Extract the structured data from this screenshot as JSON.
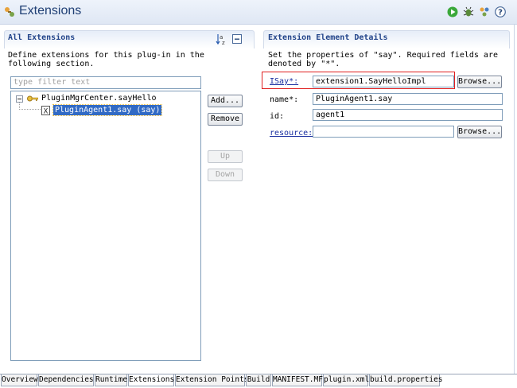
{
  "header": {
    "title": "Extensions"
  },
  "left": {
    "section_title": "All Extensions",
    "description": "Define extensions for this plug-in in the following section.",
    "filter_placeholder": "type filter text",
    "tree": {
      "root_label": "PluginMgrCenter.sayHello",
      "child_label": "PluginAgent1.say (say)"
    },
    "buttons": {
      "add": "Add...",
      "remove": "Remove",
      "up": "Up",
      "down": "Down"
    }
  },
  "right": {
    "section_title": "Extension Element Details",
    "description": "Set the properties of \"say\". Required fields are denoted by \"*\".",
    "fields": {
      "isay": {
        "label": "ISay*:",
        "value": "extension1.SayHelloImpl",
        "browse": "Browse..."
      },
      "name": {
        "label": "name*:",
        "value": "PluginAgent1.say"
      },
      "id": {
        "label": "id:",
        "value": "agent1"
      },
      "resource": {
        "label": "resource:",
        "value": "",
        "browse": "Browse..."
      }
    }
  },
  "tabs": [
    "Overview",
    "Dependencies",
    "Runtime",
    "Extensions",
    "Extension Points",
    "Build",
    "MANIFEST.MF",
    "plugin.xml",
    "build.properties"
  ],
  "active_tab": "Extensions",
  "colors": {
    "highlight_box": "#e02020",
    "selection": "#316ac5",
    "title_text": "#1f3f74",
    "section_text": "#22448a"
  }
}
